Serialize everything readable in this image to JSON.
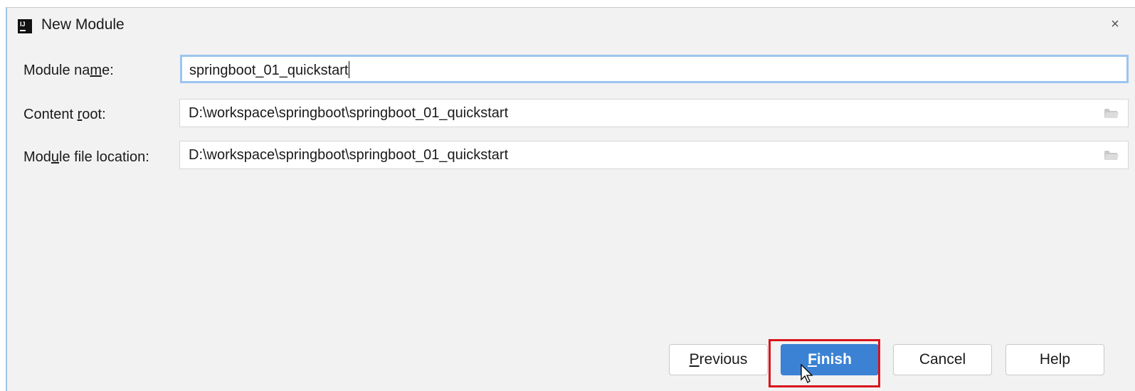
{
  "window": {
    "title": "New Module",
    "close_icon": "×"
  },
  "form": {
    "module_name": {
      "label_pre": "Module na",
      "label_mnemonic": "m",
      "label_post": "e:",
      "value": "springboot_01_quickstart"
    },
    "content_root": {
      "label_pre": "Content ",
      "label_mnemonic": "r",
      "label_post": "oot:",
      "value": "D:\\workspace\\springboot\\springboot_01_quickstart"
    },
    "module_file_location": {
      "label_pre": "Mod",
      "label_mnemonic": "u",
      "label_post": "le file location:",
      "value": "D:\\workspace\\springboot\\springboot_01_quickstart"
    }
  },
  "buttons": {
    "previous": {
      "mnemonic": "P",
      "rest": "revious"
    },
    "finish": {
      "mnemonic": "F",
      "rest": "inish"
    },
    "cancel": "Cancel",
    "help": "Help"
  },
  "colors": {
    "accent": "#3b82d4",
    "focus_border": "#9cc4ef",
    "highlight_box": "#d9141d"
  },
  "icons": [
    "intellij-app-icon",
    "close-icon",
    "folder-icon"
  ]
}
